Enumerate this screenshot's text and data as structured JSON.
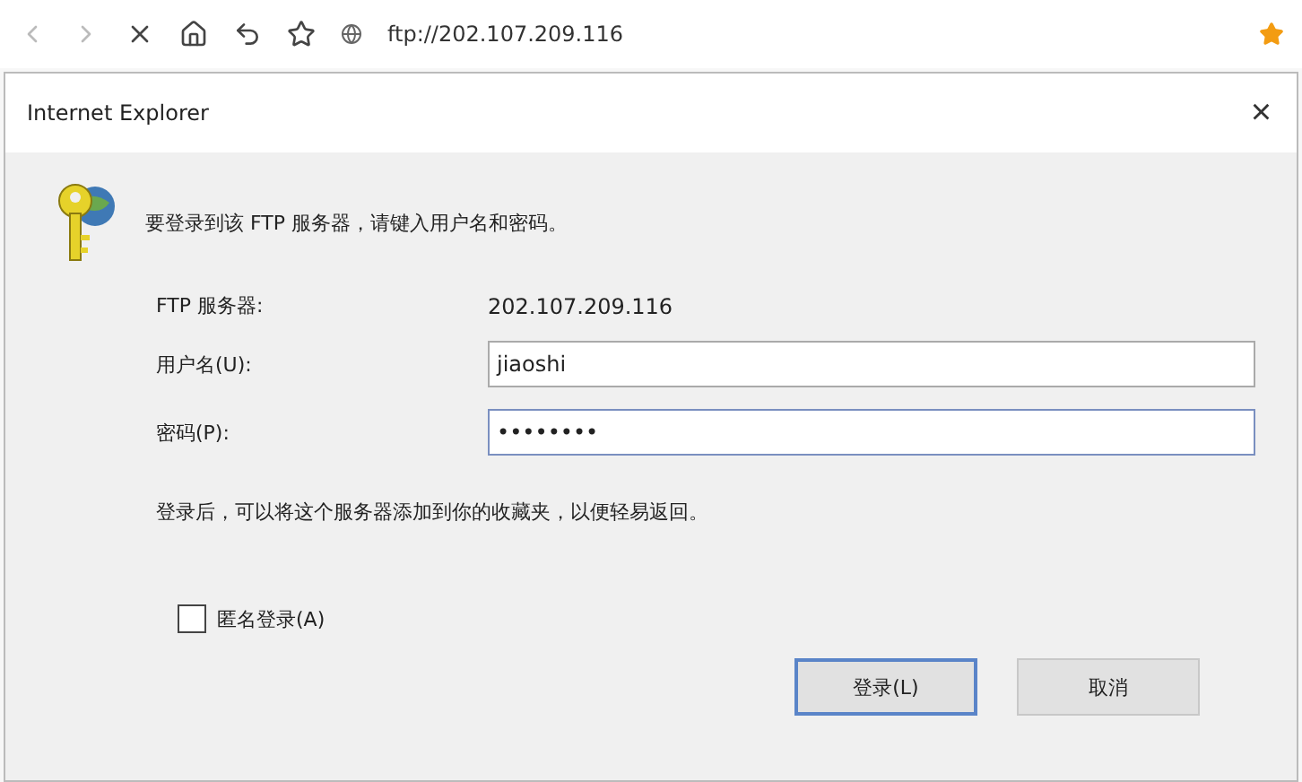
{
  "browser": {
    "address": "ftp://202.107.209.116"
  },
  "dialog": {
    "title": "Internet Explorer",
    "close": "×",
    "message": "要登录到该 FTP 服务器，请键入用户名和密码。",
    "fields": [
      {
        "kind": "static",
        "label": "FTP 服务器:",
        "value": "202.107.209.116"
      },
      {
        "kind": "input",
        "label": "用户名(U):",
        "value": "jiaoshi"
      },
      {
        "kind": "input",
        "label": "密码(P):",
        "value": "••••••••"
      }
    ],
    "note": "登录后，可以将这个服务器添加到你的收藏夹，以便轻易返回。",
    "anonymous": {
      "label": "匿名登录(A)",
      "checked": false
    },
    "buttons": [
      {
        "label": "登录(L)",
        "selected": true
      },
      {
        "label": "取消",
        "selected": false
      }
    ]
  }
}
